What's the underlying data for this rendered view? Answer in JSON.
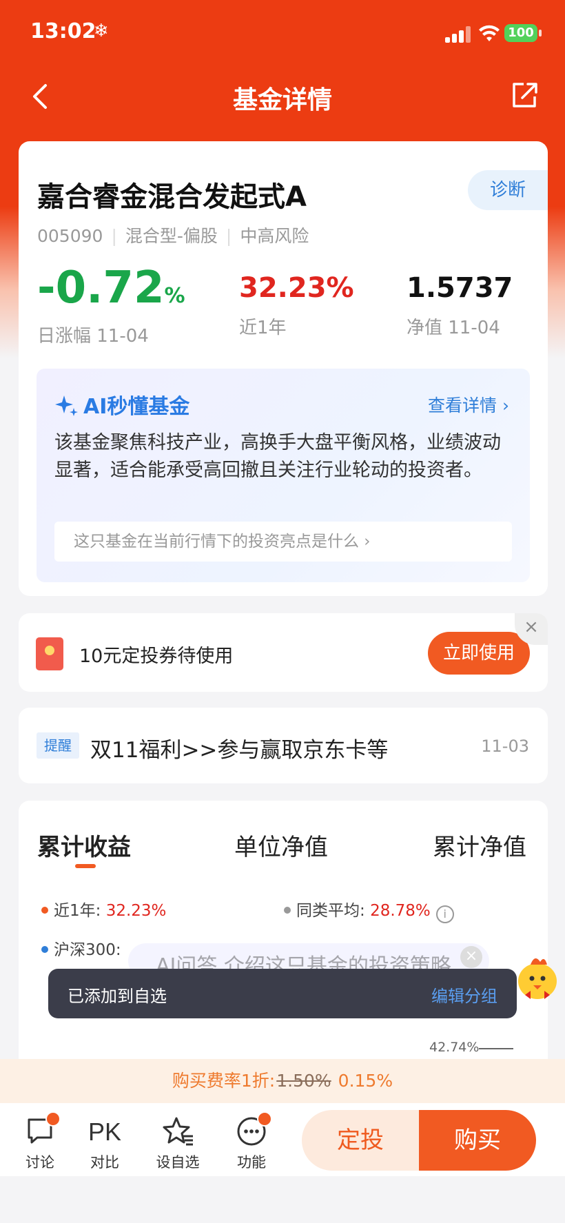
{
  "status_bar": {
    "time": "13:02",
    "snow_glyph": "❄",
    "battery": "100"
  },
  "nav": {
    "title": "基金详情"
  },
  "fund": {
    "name": "嘉合睿金混合发起式A",
    "diagnose_label": "诊断",
    "code": "005090",
    "type": "混合型-偏股",
    "risk": "中高风险",
    "daily_change": "-0.72",
    "daily_change_unit": "%",
    "daily_change_label": "日涨幅 11-04",
    "year_return": "32.23%",
    "year_return_label": "近1年",
    "nav_value": "1.5737",
    "nav_label": "净值 11-04"
  },
  "ai_summary": {
    "title": "AI秒懂基金",
    "more_label": "查看详情 ›",
    "text": "该基金聚焦科技产业，高换手大盘平衡风格，业绩波动显著，适合能承受高回撤且关注行业轮动的投资者。",
    "question": "这只基金在当前行情下的投资亮点是什么 ›"
  },
  "coupon": {
    "text": "10元定投券待使用",
    "button": "立即使用",
    "close": "×"
  },
  "reminder": {
    "tag": "提醒",
    "text": "双11福利>>参与赢取京东卡等",
    "date": "11-03"
  },
  "chart_tabs": {
    "tabs": [
      "累计收益",
      "单位净值",
      "累计净值"
    ],
    "active_index": 0
  },
  "chart_legend": {
    "this_label": "近1年:",
    "this_value": "32.23%",
    "peer_label": "同类平均:",
    "peer_value": "28.78%",
    "index_label": "沪深300:",
    "peak_label": "42.74%",
    "colors": {
      "this": "#f15a22",
      "peer": "#999999",
      "index": "#2f7ed8"
    }
  },
  "ai_float": {
    "text": "AI问答 介绍这只基金的投资策略",
    "close": "×"
  },
  "toast": {
    "text": "已添加到自选",
    "action": "编辑分组"
  },
  "fee": {
    "prefix": "购买费率1折:",
    "old": "1.50%",
    "new": "0.15%"
  },
  "bottom_bar": {
    "discuss": "讨论",
    "pk_glyph": "PK",
    "compare": "对比",
    "watchlist": "设自选",
    "functions": "功能",
    "plan_button": "定投",
    "buy_button": "购买"
  },
  "colors": {
    "brand_red": "#ec3c12",
    "orange": "#f15a22",
    "up": "#e0261f",
    "down": "#1aa64a",
    "link_blue": "#2f7ed8"
  }
}
